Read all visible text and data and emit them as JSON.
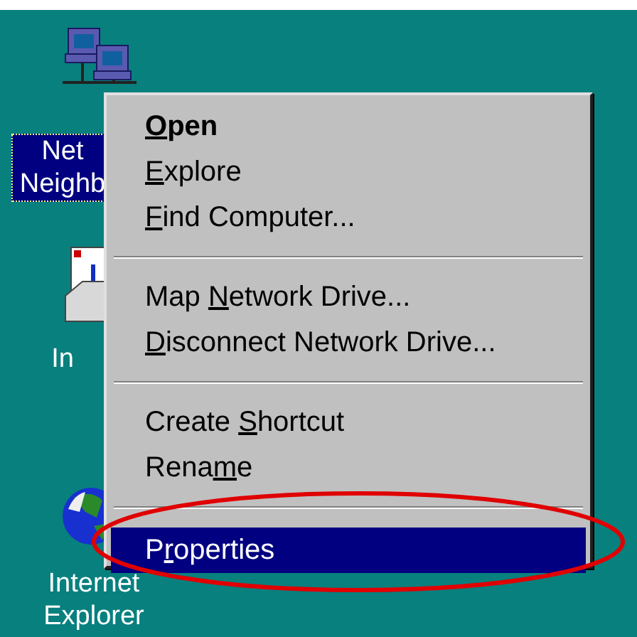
{
  "desktop_icons": [
    {
      "kind": "network",
      "label_lines": [
        "Net",
        "Neighb"
      ],
      "selected": true
    },
    {
      "kind": "inbox",
      "label_lines": [
        "In"
      ],
      "selected": false
    },
    {
      "kind": "globe",
      "label_lines": [
        "Internet",
        "Explorer"
      ],
      "selected": false
    }
  ],
  "context_menu": {
    "items": [
      {
        "kind": "item",
        "key": "O",
        "post": "pen",
        "default": true,
        "selected": false
      },
      {
        "kind": "item",
        "key": "E",
        "post": "xplore",
        "default": false,
        "selected": false
      },
      {
        "kind": "item",
        "key": "F",
        "post": "ind Computer...",
        "default": false,
        "selected": false
      },
      {
        "kind": "separator"
      },
      {
        "kind": "item",
        "pre": "Map ",
        "key": "N",
        "post": "etwork Drive...",
        "default": false,
        "selected": false
      },
      {
        "kind": "item",
        "key": "D",
        "post": "isconnect Network Drive...",
        "default": false,
        "selected": false
      },
      {
        "kind": "separator"
      },
      {
        "kind": "item",
        "pre": "Create ",
        "key": "S",
        "post": "hortcut",
        "default": false,
        "selected": false
      },
      {
        "kind": "item",
        "pre": "Rena",
        "key": "m",
        "post": "e",
        "default": false,
        "selected": false
      },
      {
        "kind": "separator"
      },
      {
        "kind": "item",
        "pre": "P",
        "key": "r",
        "post": "operties",
        "default": false,
        "selected": true
      }
    ]
  }
}
